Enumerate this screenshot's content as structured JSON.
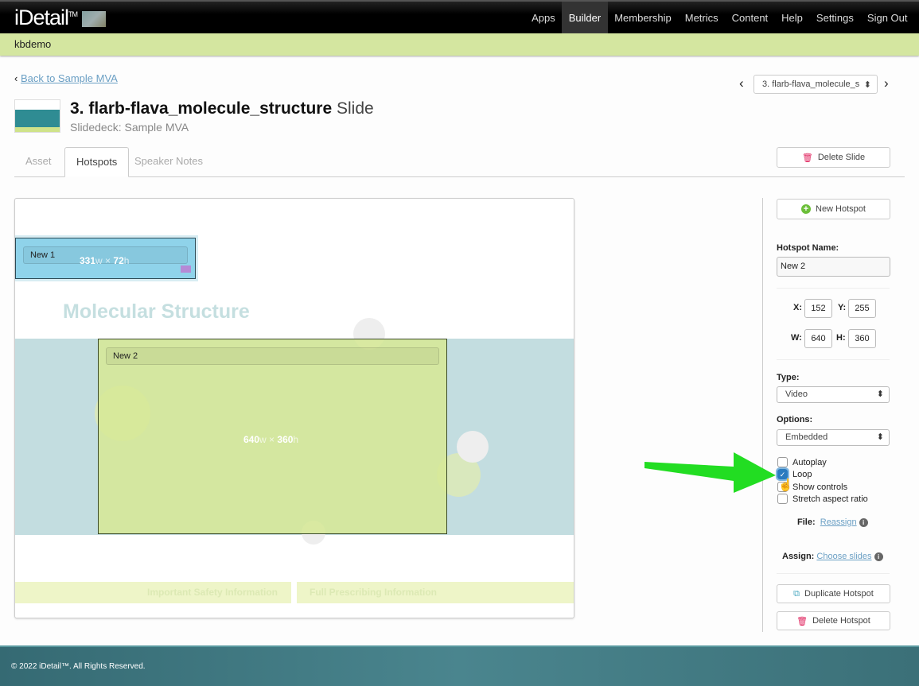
{
  "nav": {
    "logo": "iDetail",
    "logo_tm": "TM",
    "items": [
      {
        "label": "Apps",
        "active": false
      },
      {
        "label": "Builder",
        "active": true
      },
      {
        "label": "Membership",
        "active": false
      },
      {
        "label": "Metrics",
        "active": false
      },
      {
        "label": "Content",
        "active": false
      },
      {
        "label": "Help",
        "active": false
      },
      {
        "label": "Settings",
        "active": false
      },
      {
        "label": "Sign Out",
        "active": false
      }
    ]
  },
  "account": "kbdemo",
  "back_link": "Back to Sample MVA",
  "slide_selector": {
    "value": "3. flarb-flava_molecule_s"
  },
  "header": {
    "title": "3.  flarb-flava_molecule_structure",
    "title_suffix": "Slide",
    "subtitle": "Slidedeck: Sample MVA"
  },
  "tabs": [
    {
      "label": "Asset",
      "active": false
    },
    {
      "label": "Hotspots",
      "active": true
    },
    {
      "label": "Speaker Notes",
      "active": false
    }
  ],
  "delete_slide": "Delete Slide",
  "slide": {
    "title": "Molecular Structure",
    "footer_left": "Important Safety Information",
    "footer_right": "Full Prescribing Information"
  },
  "hotspots": [
    {
      "name": "New 1",
      "w": "331",
      "h": "72",
      "w_unit": "w",
      "h_unit": "h",
      "color": "#8fd3ea"
    },
    {
      "name": "New 2",
      "w": "640",
      "h": "360",
      "w_unit": "w",
      "h_unit": "h",
      "color": "#d6e896"
    }
  ],
  "panel": {
    "new_hotspot": "New Hotspot",
    "name_label": "Hotspot Name:",
    "name_value": "New 2",
    "x_label": "X:",
    "x": "152",
    "y_label": "Y:",
    "y": "255",
    "w_label": "W:",
    "w": "640",
    "h_label": "H:",
    "h": "360",
    "type_label": "Type:",
    "type_value": "Video",
    "options_label": "Options:",
    "options_value": "Embedded",
    "checkboxes": [
      {
        "label": "Autoplay",
        "checked": false
      },
      {
        "label": "Loop",
        "checked": true
      },
      {
        "label": "Show controls",
        "checked": false
      },
      {
        "label": "Stretch aspect ratio",
        "checked": false
      }
    ],
    "file_label": "File:",
    "file_link": "Reassign",
    "assign_label": "Assign:",
    "assign_link": "Choose slides",
    "duplicate": "Duplicate Hotspot",
    "delete": "Delete Hotspot"
  },
  "footer": "© 2022 iDetail™.  All Rights Reserved.",
  "colors": {
    "nav": "#000000",
    "subbar": "#d4e6a0",
    "link": "#6a9fc4",
    "delete_icon": "#e0245e",
    "add_icon": "#6cbf3a",
    "footer": "#3d7680",
    "arrow": "#22dd22"
  }
}
